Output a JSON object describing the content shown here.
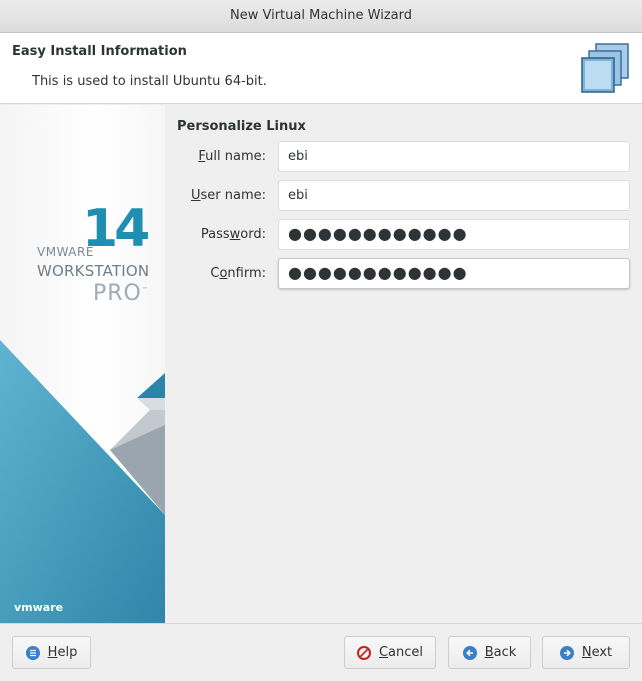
{
  "window": {
    "title": "New Virtual Machine Wizard"
  },
  "header": {
    "title": "Easy Install Information",
    "subtitle": "This is used to install Ubuntu 64-bit."
  },
  "branding": {
    "vmware": "VMWARE",
    "version": "14",
    "product": "WORKSTATION",
    "edition": "PRO",
    "trademark": "™",
    "footer_logo": "vmware"
  },
  "form": {
    "title": "Personalize Linux",
    "fields": [
      {
        "label_mnemonic": "F",
        "label_rest": "ull name:",
        "value": "ebi",
        "type": "text"
      },
      {
        "label_mnemonic": "U",
        "label_rest": "ser name:",
        "value": "ebi",
        "type": "text"
      },
      {
        "label_pre": "Pass",
        "label_mnemonic": "w",
        "label_rest": "ord:",
        "value": "●●●●●●●●●●●●",
        "type": "password"
      },
      {
        "label_pre": "C",
        "label_mnemonic": "o",
        "label_rest": "nfirm:",
        "value": "●●●●●●●●●●●●",
        "type": "password"
      }
    ]
  },
  "buttons": {
    "help": {
      "mnemonic": "H",
      "rest": "elp",
      "icon": "menu-lines-icon"
    },
    "cancel": {
      "mnemonic": "C",
      "rest": "ancel",
      "icon": "no-entry-icon"
    },
    "back": {
      "mnemonic": "B",
      "rest": "ack",
      "icon": "arrow-left-icon"
    },
    "next": {
      "mnemonic": "N",
      "rest": "ext",
      "icon": "arrow-right-icon"
    }
  },
  "colors": {
    "accent_blue": "#1e8fb0",
    "button_icon_blue": "#3a7fc9",
    "cancel_red": "#cc1f1f"
  }
}
